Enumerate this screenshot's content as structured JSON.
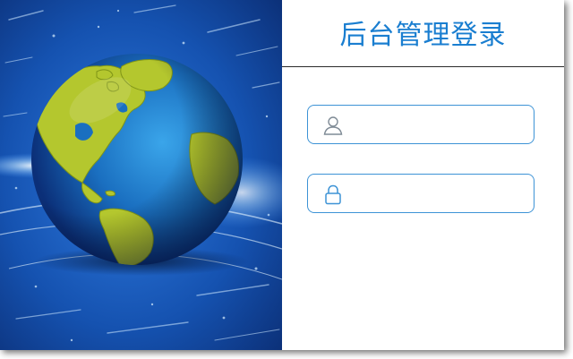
{
  "login": {
    "title": "后台管理登录",
    "username": {
      "value": "",
      "placeholder": "",
      "icon": "user-icon"
    },
    "password": {
      "value": "",
      "placeholder": "",
      "icon": "lock-icon"
    }
  },
  "hero": {
    "subject": "globe-illustration"
  },
  "colors": {
    "accent": "#1a7ed0",
    "field_border": "#3d93d6",
    "hero_background": "#0f3f8c",
    "globe_ocean": "#1a6fc0",
    "globe_land": "#b4c72e"
  }
}
